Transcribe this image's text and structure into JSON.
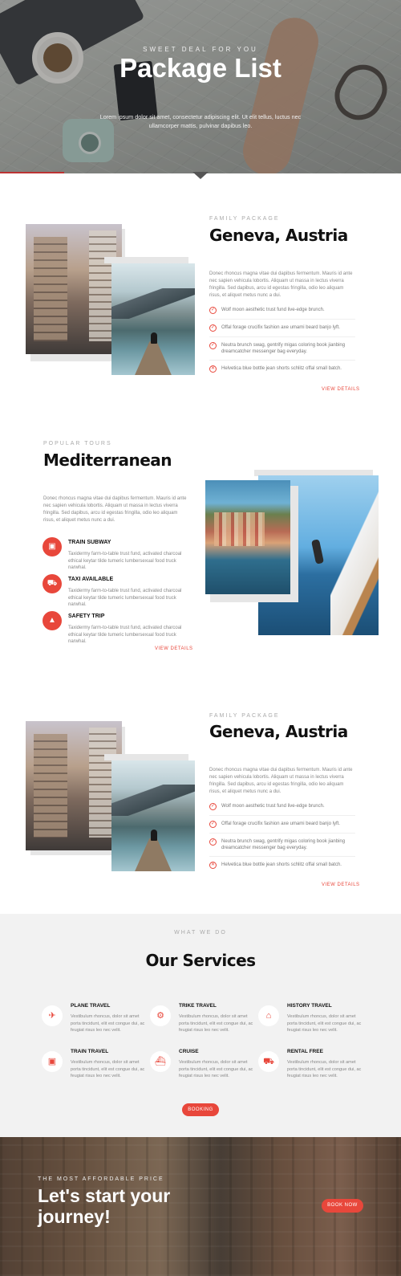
{
  "hero": {
    "subtitle": "SWEET DEAL FOR YOU",
    "title": "Package List",
    "text": "Lorem ipsum dolor sit amet, consectetur adipiscing elit. Ut elit tellus, luctus nec ullamcorper mattis, pulvinar dapibus leo."
  },
  "packages": [
    {
      "eyebrow": "FAMILY PACKAGE",
      "title": "Geneva, Austria",
      "text": "Donec rhoncus magna vitae dui dapibus fermentum. Mauris id ante nec sapien vehicula lobortis. Aliquam ut massa in lectus viverra fringilla. Sed dapibus, arcu id egestas fringilla, odio leo aliquam risus, et aliquet metus nunc a dui.",
      "items": [
        {
          "icon": "check",
          "text": "Wolf moon aesthetic trust fund live-edge brunch."
        },
        {
          "icon": "check",
          "text": "Offal forage crucifix fashion axe umami beard banjo lyft."
        },
        {
          "icon": "check",
          "text": "Neutra brunch swag, gentrify migas coloring book jianbing dreamcatcher messenger bag everyday."
        },
        {
          "icon": "cross",
          "text": "Helvetica blue bottle jean shorts schlitz offal small batch."
        }
      ],
      "link": "VIEW DETAILS"
    },
    {
      "eyebrow": "FAMILY PACKAGE",
      "title": "Geneva, Austria",
      "text": "Donec rhoncus magna vitae dui dapibus fermentum. Mauris id ante nec sapien vehicula lobortis. Aliquam ut massa in lectus viverra fringilla. Sed dapibus, arcu id egestas fringilla, odio leo aliquam risus, et aliquet metus nunc a dui.",
      "items": [
        {
          "icon": "check",
          "text": "Wolf moon aesthetic trust fund live-edge brunch."
        },
        {
          "icon": "check",
          "text": "Offal forage crucifix fashion axe umami beard banjo lyft."
        },
        {
          "icon": "check",
          "text": "Neutra brunch swag, gentrify migas coloring book jianbing dreamcatcher messenger bag everyday."
        },
        {
          "icon": "cross",
          "text": "Helvetica blue bottle jean shorts schlitz offal small batch."
        }
      ],
      "link": "VIEW DETAILS"
    }
  ],
  "popular": {
    "eyebrow": "POPULAR TOURS",
    "title": "Mediterranean",
    "text": "Donec rhoncus magna vitae dui dapibus fermentum. Mauris id ante nec sapien vehicula lobortis. Aliquam ut massa in lectus viverra fringilla. Sed dapibus, arcu id egestas fringilla, odio leo aliquam risus, et aliquet metus nunc a dui.",
    "features": [
      {
        "icon": "train-icon",
        "glyph": "▣",
        "title": "TRAIN SUBWAY",
        "text": "Taxidermy farm-to-table trust fund, activated charcoal ethical keytar tilde tumeric lumbersexual food truck narwhal."
      },
      {
        "icon": "taxi-icon",
        "glyph": "⛟",
        "title": "TAXI AVAILABLE",
        "text": "Taxidermy farm-to-table trust fund, activated charcoal ethical keytar tilde tumeric lumbersexual food truck narwhal."
      },
      {
        "icon": "bell-icon",
        "glyph": "▲",
        "title": "SAFETY TRIP",
        "text": "Taxidermy farm-to-table trust fund, activated charcoal ethical keytar tilde tumeric lumbersexual food truck narwhal."
      }
    ],
    "link": "VIEW DETAILS"
  },
  "services": {
    "eyebrow": "WHAT WE DO",
    "title": "Our Services",
    "items": [
      {
        "icon": "plane-icon",
        "glyph": "✈",
        "title": "PLANE TRAVEL",
        "text": "Vestibulum rhoncus, dolor sit amet porta tincidunt, elit est congue dui, ac feugiat risus leo nec velit."
      },
      {
        "icon": "motorbike-icon",
        "glyph": "⚙",
        "title": "TRIKE TRAVEL",
        "text": "Vestibulum rhoncus, dolor sit amet porta tincidunt, elit est congue dui, ac feugiat risus leo nec velit."
      },
      {
        "icon": "landmark-icon",
        "glyph": "⌂",
        "title": "HISTORY TRAVEL",
        "text": "Vestibulum rhoncus, dolor sit amet porta tincidunt, elit est congue dui, ac feugiat risus leo nec velit."
      },
      {
        "icon": "train-icon",
        "glyph": "▣",
        "title": "TRAIN TRAVEL",
        "text": "Vestibulum rhoncus, dolor sit amet porta tincidunt, elit est congue dui, ac feugiat risus leo nec velit."
      },
      {
        "icon": "ship-icon",
        "glyph": "⛴",
        "title": "CRUISE",
        "text": "Vestibulum rhoncus, dolor sit amet porta tincidunt, elit est congue dui, ac feugiat risus leo nec velit."
      },
      {
        "icon": "car-icon",
        "glyph": "⛟",
        "title": "RENTAL FREE",
        "text": "Vestibulum rhoncus, dolor sit amet porta tincidunt, elit est congue dui, ac feugiat risus leo nec velit."
      }
    ],
    "button": "BOOKING"
  },
  "cta": {
    "subtitle": "THE MOST AFFORDABLE PRICE",
    "title": "Let's start your journey!",
    "button": "BOOK NOW"
  },
  "colors": {
    "accent": "#e8473b",
    "services_bg": "#f2f2f2"
  }
}
